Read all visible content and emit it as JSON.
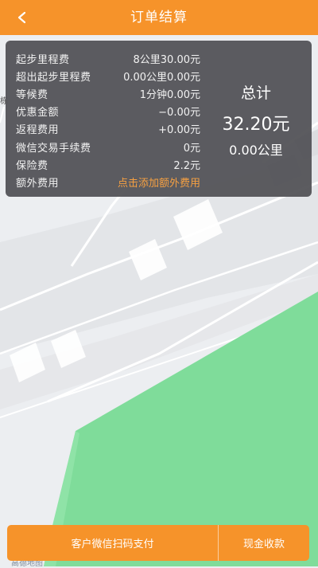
{
  "header": {
    "title": "订单结算"
  },
  "fees": [
    {
      "label": "起步里程费",
      "value": "8公里30.00元"
    },
    {
      "label": "超出起步里程费",
      "value": "0.00公里0.00元"
    },
    {
      "label": "等候费",
      "value": "1分钟0.00元"
    },
    {
      "label": "优惠金额",
      "value": "−0.00元"
    },
    {
      "label": "返程费用",
      "value": "+0.00元"
    },
    {
      "label": "微信交易手续费",
      "value": "0元"
    },
    {
      "label": "保险费",
      "value": "2.2元"
    },
    {
      "label": "额外费用",
      "value": "点击添加额外费用"
    }
  ],
  "total": {
    "label": "总计",
    "amount": "32.20元",
    "distance": "0.00公里"
  },
  "map": {
    "side_label": "栋",
    "logo_text": "高德地图"
  },
  "actions": {
    "wechat_pay": "客户微信扫码支付",
    "cash": "现金收款"
  },
  "colors": {
    "accent": "#f6932a",
    "panel": "#525256",
    "link": "#f6a042",
    "park": "#7fdc9a"
  }
}
